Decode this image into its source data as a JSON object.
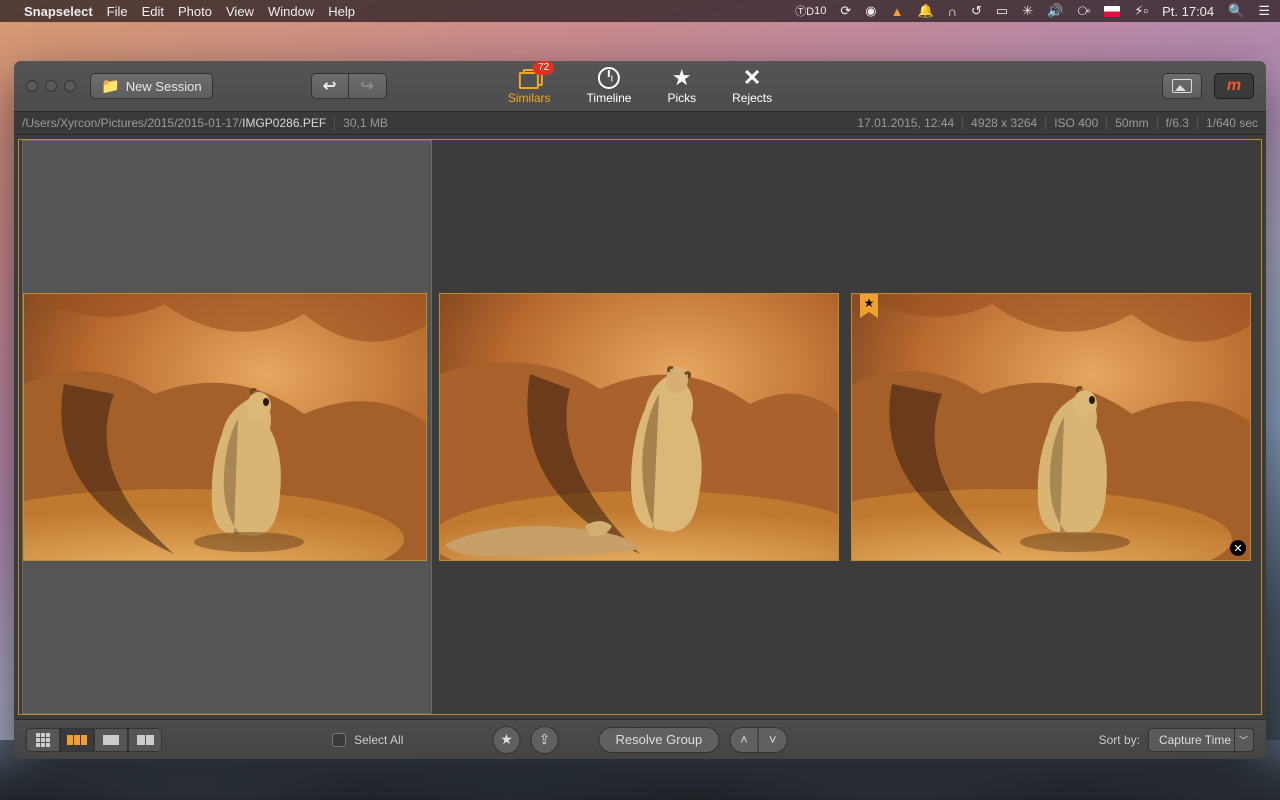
{
  "menubar": {
    "app": "Snapselect",
    "items": [
      "File",
      "Edit",
      "Photo",
      "View",
      "Window",
      "Help"
    ],
    "td_label": "10",
    "day": "Pt.",
    "time": "17:04"
  },
  "toolbar": {
    "new_session": "New Session",
    "modes": {
      "similars": "Similars",
      "similars_badge": "72",
      "timeline": "Timeline",
      "picks": "Picks",
      "rejects": "Rejects"
    },
    "pro_label": "m"
  },
  "infobar": {
    "path_prefix": "/Users/Xyrcon/Pictures/2015/2015-01-17/",
    "filename": "IMGP0286.PEF",
    "filesize": "30,1 MB",
    "datetime": "17.01.2015, 12:44",
    "dimensions": "4928 x 3264",
    "iso": "ISO 400",
    "focal": "50mm",
    "aperture": "f/6.3",
    "shutter": "1/640 sec"
  },
  "thumbs": [
    {
      "selected": true,
      "picked": false,
      "rejected": false
    },
    {
      "selected": false,
      "picked": false,
      "rejected": false
    },
    {
      "selected": false,
      "picked": true,
      "rejected": true
    }
  ],
  "bottombar": {
    "select_all": "Select All",
    "resolve_group": "Resolve Group",
    "sort_by_label": "Sort by:",
    "sort_by_value": "Capture Time"
  }
}
